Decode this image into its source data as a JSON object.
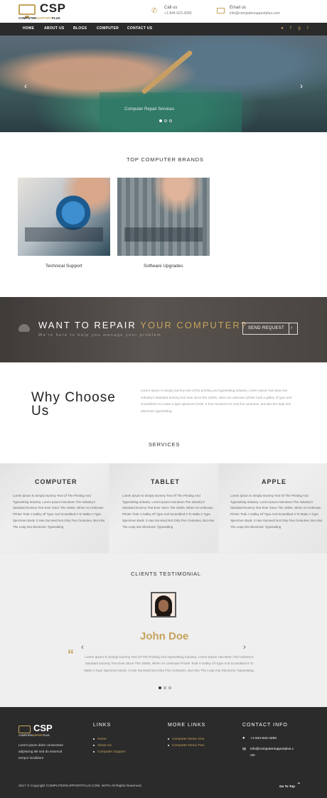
{
  "brand": {
    "logo_main": "CSP",
    "logo_sub_a": "COMPUTER",
    "logo_sub_b": "SUPPORT",
    "logo_sub_c": "PLUS"
  },
  "header": {
    "call_label": "Call us",
    "call_value": "+1-844-622-4283",
    "email_label": "Email us",
    "email_value": "info@computersupportplus.com"
  },
  "nav": {
    "items": [
      "HOME",
      "ABOUT US",
      "BLOGS",
      "COMPUTER",
      "CONTACT US"
    ],
    "social_icons": [
      "pinterest-icon",
      "facebook-icon",
      "google-plus-icon",
      "twitter-icon"
    ]
  },
  "hero": {
    "caption": "Computer Repair Services",
    "slide_active": 1,
    "slide_count": 3
  },
  "brands": {
    "title": "TOP COMPUTER BRANDS",
    "items": [
      {
        "caption": "Technical Support"
      },
      {
        "caption": "Software Upgrades"
      }
    ]
  },
  "repair": {
    "title_a": "WANT TO REPAIR ",
    "title_b": "YOUR COMPUTER?",
    "subtitle": "We're here to help you manage your problem",
    "button_label": "SEND REQUEST",
    "button_icon": "chevron-right-icon"
  },
  "why": {
    "title": "Why Choose Us",
    "text": "Lorem Ipsum is simply dummy text of the printing and typesetting industry. Lorem Ipsum has been the industry's standard dummy text ever since the 1500s, when an unknown printer took a galley of type and scrambled it to make a type specimen book. It has survived not only five centuries, but also the leap into electronic typesetting."
  },
  "services": {
    "title": "SERVICES",
    "items": [
      {
        "title": "COMPUTER",
        "body": "Lorem Ipsum Is Simply Dummy Text Of The Printing And Typesetting Industry. Lorem Ipsum Has Been The Industry's Standard Dummy Text Ever Since The 1500s, When An Unknown Printer Took A Galley Of Type And Scrambled It To Make A Type Specimen Book. It Has Survived Not Only Five Centuries, But Also The Leap Into Electronic Typesetting"
      },
      {
        "title": "TABLET",
        "body": "Lorem Ipsum Is Simply Dummy Text Of The Printing And Typesetting Industry. Lorem Ipsum Has Been The Industry's Standard Dummy Text Ever Since The 1500s, When An Unknown Printer Took A Galley Of Type And Scrambled It To Make A Type Specimen Book. It Has Survived Not Only Five Centuries, But Also The Leap Into Electronic Typesetting"
      },
      {
        "title": "APPLE",
        "body": "Lorem Ipsum Is Simply Dummy Text Of The Printing And Typesetting Industry. Lorem Ipsum Has Been The Industry's Standard Dummy Text Ever Since The 1500s, When An Unknown Printer Took A Galley Of Type And Scrambled It To Make A Type Specimen Book. It Has Survived Not Only Five Centuries, But Also The Leap Into Electronic Typesetting"
      }
    ]
  },
  "testimonial": {
    "title": "CLIENTS TESTIMONIAL",
    "name": "John Doe",
    "quote_mark": "“",
    "body": "Lorem Ipsum Is Simply Dummy Text Of The Printing And Typesetting Industry. Lorem Ipsum Has Been The Industry's Standard Dummy Text Ever Since The 1500s, When An Unknown Printer Took A Galley Of Type And Scrambled It To Make A Type Specimen Book. It Has Survived Not Only Five Centuries, But Also The Leap Into Electronic Typesetting.",
    "slide_active": 1,
    "slide_count": 3
  },
  "footer": {
    "about": "Lorem ipsum dolor consectetur adipiscing elit sed do eiusmod tempor incididunt",
    "links_title": "LINKS",
    "links": [
      "Home",
      "About Us",
      "Computer Support"
    ],
    "more_title": "MORE LINKS",
    "more_links": [
      "Computer Demo One",
      "Computer Demo Two"
    ],
    "contact_title": "CONTACT INFO",
    "phone": "+1-844-622-4283",
    "email_a": "info@computersupportplus.c",
    "email_b": "om",
    "copyright": "2017 © Copyright COMPUTERSUPPORTPLUS.COM. WITH All Rights Reserved.",
    "go_top": "Go To Top"
  },
  "colors": {
    "accent": "#c6a35c",
    "nav_bg": "#2b2b2b",
    "footer_bg": "#2b2b2b"
  }
}
